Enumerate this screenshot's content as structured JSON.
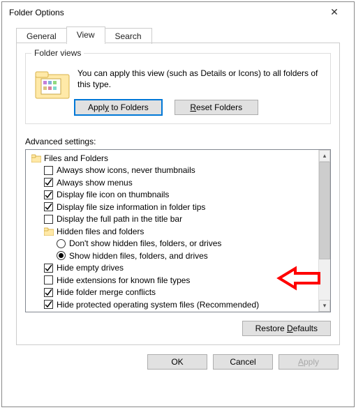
{
  "window": {
    "title": "Folder Options"
  },
  "tabs": {
    "general": "General",
    "view": "View",
    "search": "Search",
    "active": "View"
  },
  "views": {
    "legend": "Folder views",
    "text": "You can apply this view (such as Details or Icons) to all folders of this type.",
    "apply_btn": "Apply to Folders",
    "reset_btn": "Reset Folders"
  },
  "advanced": {
    "label": "Advanced settings:",
    "rootLabel": "Files and Folders",
    "hiddenGroup": "Hidden files and folders",
    "radioDont": "Don't show hidden files, folders, or drives",
    "radioShow": "Show hidden files, folders, and drives",
    "items": {
      "alwaysIcons": {
        "checked": false,
        "label": "Always show icons, never thumbnails"
      },
      "alwaysMenus": {
        "checked": true,
        "label": "Always show menus"
      },
      "fileIconThumb": {
        "checked": true,
        "label": "Display file icon on thumbnails"
      },
      "fileSizeTips": {
        "checked": true,
        "label": "Display file size information in folder tips"
      },
      "fullPathTitle": {
        "checked": false,
        "label": "Display the full path in the title bar"
      },
      "hideEmpty": {
        "checked": true,
        "label": "Hide empty drives"
      },
      "hideExt": {
        "checked": false,
        "label": "Hide extensions for known file types"
      },
      "hideMerge": {
        "checked": true,
        "label": "Hide folder merge conflicts"
      },
      "hideOS": {
        "checked": true,
        "label": "Hide protected operating system files (Recommended)"
      }
    },
    "radioSelected": "show"
  },
  "buttons": {
    "restore": "Restore Defaults",
    "ok": "OK",
    "cancel": "Cancel",
    "apply": "Apply"
  },
  "annotation": {
    "arrow_name": "red-arrow-show-hidden"
  }
}
